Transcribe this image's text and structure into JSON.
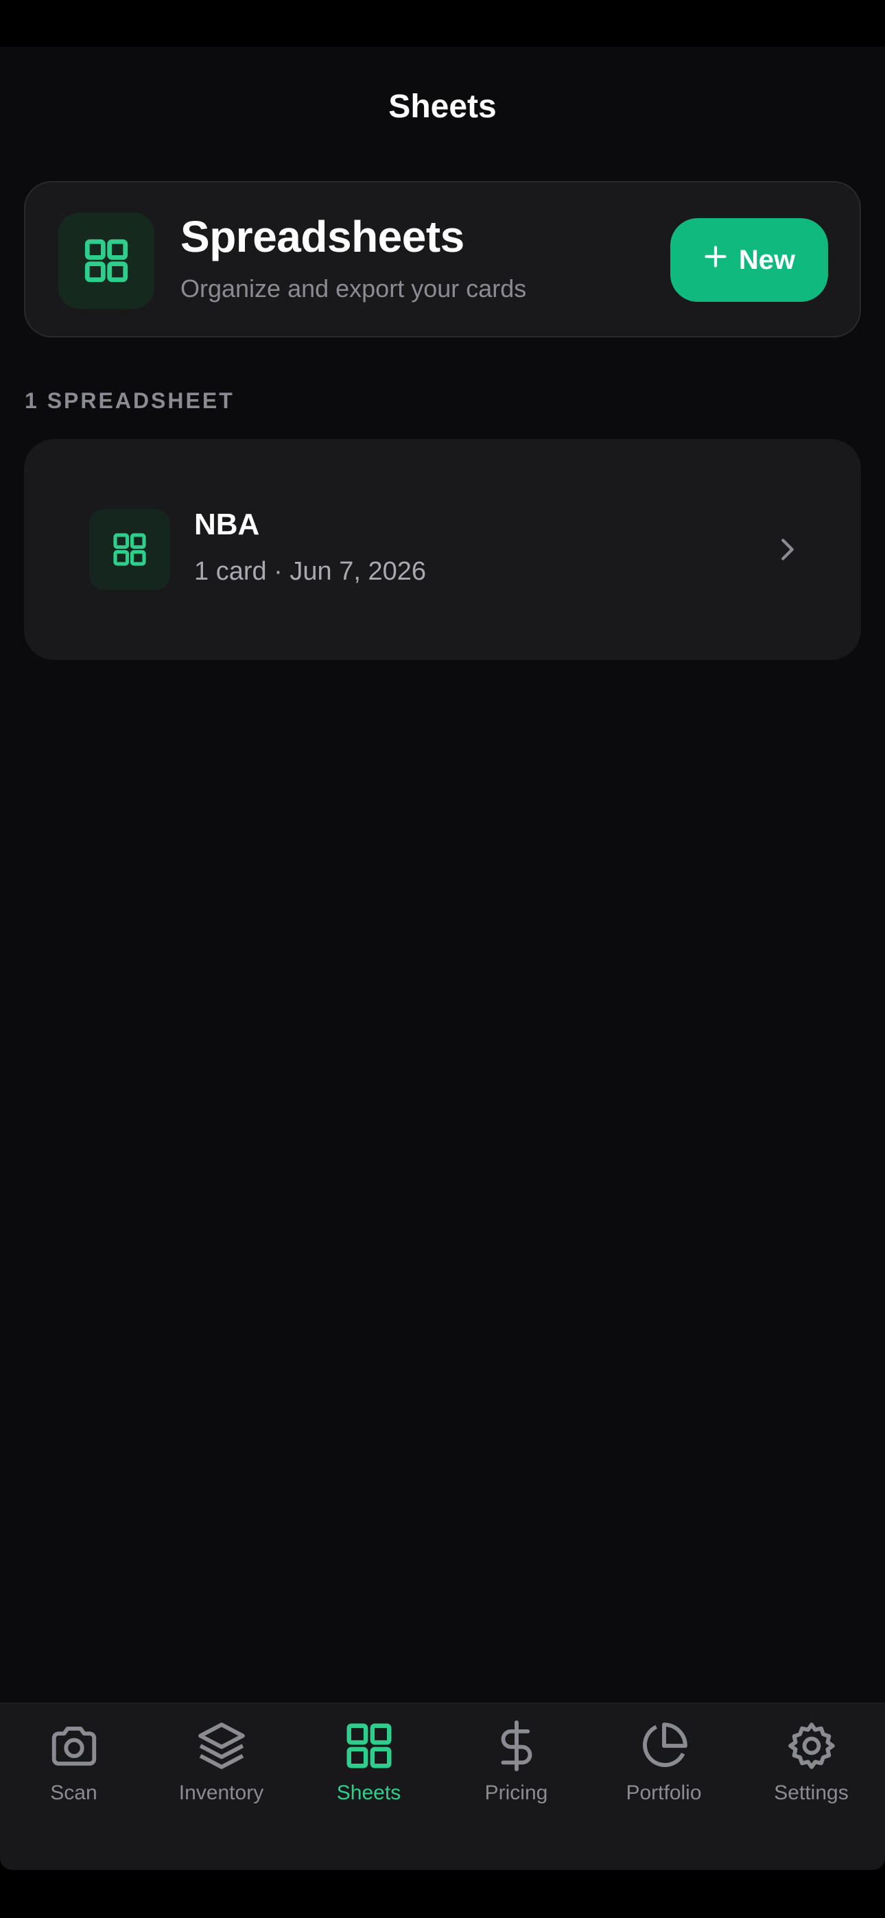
{
  "header": {
    "title": "Sheets"
  },
  "hero": {
    "icon": "grid-icon",
    "title": "Spreadsheets",
    "subtitle": "Organize and export your cards",
    "new_button": {
      "icon": "plus-icon",
      "label": "New"
    }
  },
  "section": {
    "label": "1 SPREADSHEET"
  },
  "spreadsheets": [
    {
      "icon": "grid-icon",
      "title": "NBA",
      "meta": "1 card · Jun 7, 2026",
      "chevron": "chevron-right-icon"
    }
  ],
  "tabs": [
    {
      "id": "scan",
      "label": "Scan",
      "icon": "camera-icon",
      "active": false
    },
    {
      "id": "inventory",
      "label": "Inventory",
      "icon": "layers-icon",
      "active": false
    },
    {
      "id": "sheets",
      "label": "Sheets",
      "icon": "grid-icon",
      "active": true
    },
    {
      "id": "pricing",
      "label": "Pricing",
      "icon": "dollar-icon",
      "active": false
    },
    {
      "id": "portfolio",
      "label": "Portfolio",
      "icon": "pie-chart-icon",
      "active": false
    },
    {
      "id": "settings",
      "label": "Settings",
      "icon": "gear-icon",
      "active": false
    }
  ],
  "colors": {
    "accent": "#10b97e",
    "accent_text": "#2ecf8c",
    "background": "#0b0b0d",
    "card": "#19191c",
    "muted_text": "#8b8b92"
  }
}
